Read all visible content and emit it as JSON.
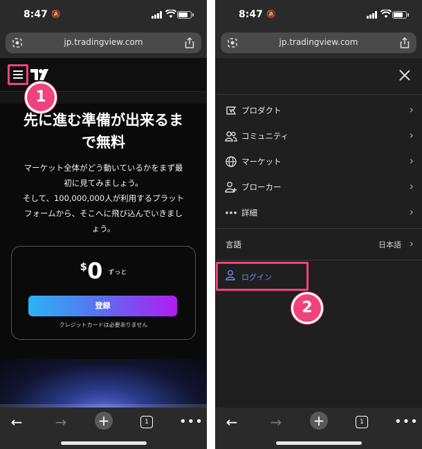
{
  "status": {
    "time": "8:47"
  },
  "browser": {
    "url": "jp.tradingview.com",
    "tab_count": "1"
  },
  "left": {
    "step_marker": "1",
    "headline_line1": "先に進む準備が出来るま",
    "headline_line2": "で無料",
    "desc_line1": "マーケット全体がどう動いているかをまず最",
    "desc_line2": "初に見てみましょう。",
    "desc_line3": "そして、100,000,000人が利用するプラット",
    "desc_line4": "フォームから、そこへに飛び込んでいきまし",
    "desc_line5": "ょう。",
    "price_currency": "$",
    "price_value": "0",
    "price_note": "ずっと",
    "register_label": "登録",
    "cc_note": "クレジットカードは必要ありません"
  },
  "menu": {
    "items": [
      {
        "label": "プロダクト",
        "icon": "product-icon"
      },
      {
        "label": "コミュニティ",
        "icon": "community-icon"
      },
      {
        "label": "マーケット",
        "icon": "globe-icon"
      },
      {
        "label": "ブローカー",
        "icon": "broker-icon"
      },
      {
        "label": "詳細",
        "icon": "more-dots-icon"
      }
    ],
    "language_label": "言語",
    "language_value": "日本語",
    "login_label": "ログイン",
    "step_marker": "2"
  },
  "colors": {
    "highlight": "#f0437d",
    "login_text": "#6b8cff"
  }
}
